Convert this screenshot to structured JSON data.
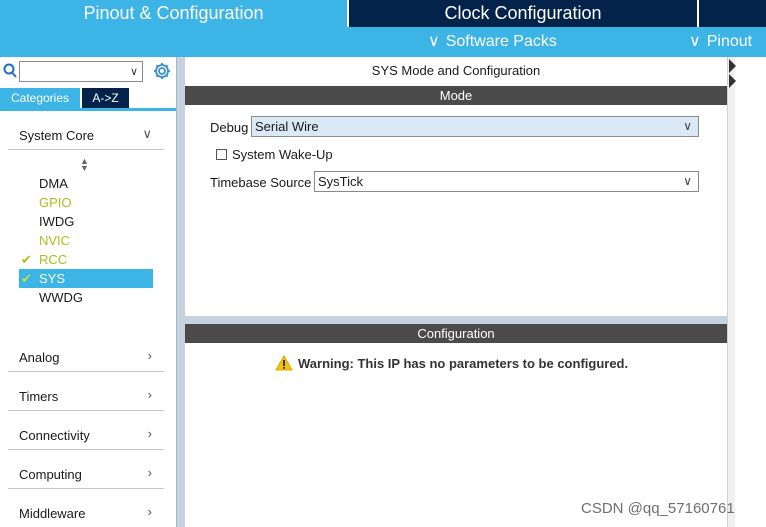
{
  "tabs": {
    "pinout": "Pinout & Configuration",
    "clock": "Clock Configuration"
  },
  "subbar": {
    "software_packs": "Software Packs",
    "pinout": "Pinout",
    "chevron": "∨"
  },
  "left": {
    "search_placeholder": "",
    "seg_categories": "Categories",
    "seg_az": "A->Z",
    "categories": [
      {
        "label": "System Core",
        "expanded": true
      },
      {
        "label": "Analog"
      },
      {
        "label": "Timers"
      },
      {
        "label": "Connectivity"
      },
      {
        "label": "Computing"
      },
      {
        "label": "Middleware"
      }
    ],
    "system_core_items": [
      {
        "name": "DMA",
        "color": "#1a1a1a",
        "checked": false
      },
      {
        "name": "GPIO",
        "color": "#a8c020",
        "checked": false
      },
      {
        "name": "IWDG",
        "color": "#1a1a1a",
        "checked": false
      },
      {
        "name": "NVIC",
        "color": "#a8c020",
        "checked": false
      },
      {
        "name": "RCC",
        "color": "#a8c020",
        "checked": true
      },
      {
        "name": "SYS",
        "color": "#ffffff",
        "checked": true,
        "selected": true
      },
      {
        "name": "WWDG",
        "color": "#1a1a1a",
        "checked": false
      }
    ]
  },
  "main": {
    "title": "SYS Mode and Configuration",
    "mode_header": "Mode",
    "debug_label": "Debug",
    "debug_value": "Serial Wire",
    "wakeup_label": "System Wake-Up",
    "timebase_label": "Timebase Source",
    "timebase_value": "SysTick",
    "config_header": "Configuration",
    "warning": "Warning: This IP has no parameters to be configured."
  },
  "watermark": "CSDN @qq_57160761",
  "colors": {
    "accent": "#3cb4e6",
    "dark": "#03234b",
    "header": "#4a4a4a",
    "lime": "#a8c020"
  }
}
